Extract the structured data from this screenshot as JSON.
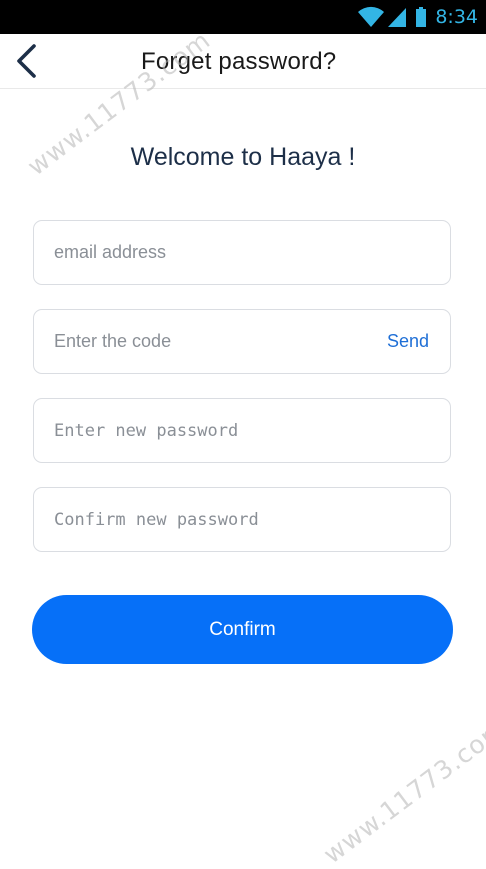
{
  "status_bar": {
    "time": "8:34",
    "icons": [
      "wifi-icon",
      "signal-icon",
      "battery-icon"
    ]
  },
  "nav": {
    "back_icon": "chevron-left-icon",
    "title": "Forget password?"
  },
  "main": {
    "welcome": "Welcome to Haaya !",
    "email_placeholder": "email address",
    "code_placeholder": "Enter the code",
    "send_label": "Send",
    "new_password_placeholder": "Enter new password",
    "confirm_password_placeholder": "Confirm new password",
    "confirm_label": "Confirm"
  },
  "watermark": {
    "text": "www.11773.com"
  },
  "colors": {
    "accent": "#0670f8",
    "link": "#1f6fd6",
    "title": "#1d2f48",
    "status_blue": "#33b5e5"
  }
}
